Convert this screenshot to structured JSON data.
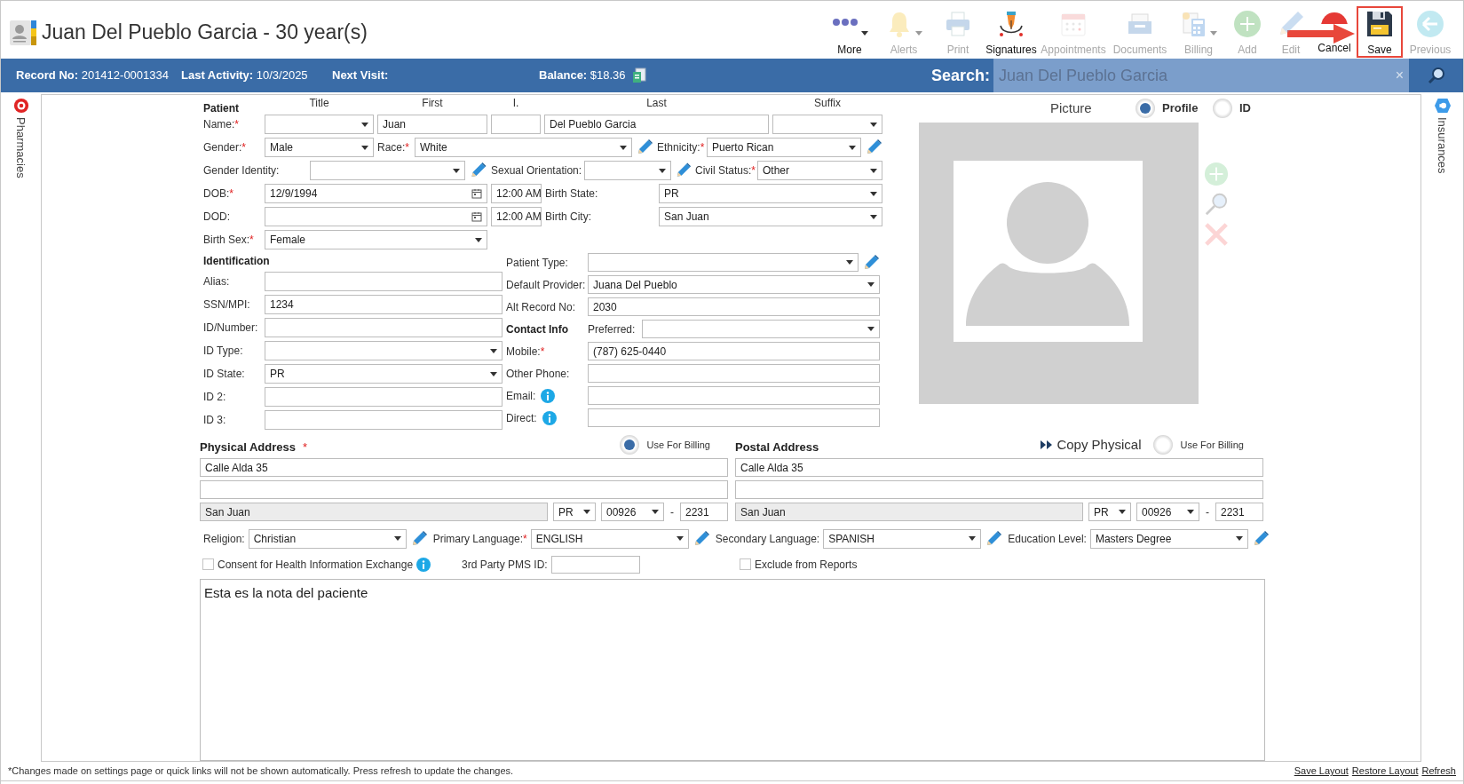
{
  "header": {
    "title": "Juan Del Pueblo Garcia - 30 year(s)"
  },
  "toolbar": [
    {
      "kind": "more",
      "label": "More",
      "disabled": false,
      "dropdown": true,
      "highlighted": false
    },
    {
      "kind": "alerts",
      "label": "Alerts",
      "disabled": true,
      "dropdown": true,
      "highlighted": false
    },
    {
      "kind": "print",
      "label": "Print",
      "disabled": true,
      "dropdown": false,
      "highlighted": false
    },
    {
      "kind": "signatures",
      "label": "Signatures",
      "disabled": false,
      "dropdown": false,
      "highlighted": false
    },
    {
      "kind": "appointments",
      "label": "Appointments",
      "disabled": true,
      "dropdown": false,
      "highlighted": false
    },
    {
      "kind": "documents",
      "label": "Documents",
      "disabled": true,
      "dropdown": false,
      "highlighted": false
    },
    {
      "kind": "billing",
      "label": "Billing",
      "disabled": true,
      "dropdown": true,
      "highlighted": false
    },
    {
      "kind": "add",
      "label": "Add",
      "disabled": true,
      "dropdown": false,
      "highlighted": false
    },
    {
      "kind": "edit",
      "label": "Edit",
      "disabled": true,
      "dropdown": false,
      "highlighted": false
    },
    {
      "kind": "cancel",
      "label": "Cancel",
      "disabled": false,
      "dropdown": false,
      "highlighted": false
    },
    {
      "kind": "save",
      "label": "Save",
      "disabled": false,
      "dropdown": false,
      "highlighted": true
    },
    {
      "kind": "previous",
      "label": "Previous",
      "disabled": true,
      "dropdown": false,
      "highlighted": false
    }
  ],
  "info_bar": [
    {
      "label": "Record No:",
      "value": "201412-0001334"
    },
    {
      "label": "Last Activity:",
      "value": "10/3/2025"
    },
    {
      "label": "Next Visit:"
    },
    {
      "label": "Balance:",
      "value": "$18.36"
    }
  ],
  "search": {
    "label": "Search:",
    "value": "Juan Del Pueblo Garcia",
    "clear": "×"
  },
  "side_tabs": {
    "left": "Pharmacies",
    "right": "Insurances"
  },
  "patient": {
    "heading": "Patient",
    "columns": [
      "Title",
      "First",
      "I.",
      "Last",
      "Suffix"
    ],
    "rows": [
      [
        {
          "kind": "label",
          "text": "Name:",
          "required_mark": "*"
        },
        {
          "kind": "select"
        },
        {
          "kind": "text",
          "value": "Juan"
        },
        {
          "kind": "text"
        },
        {
          "kind": "text",
          "value": "Del Pueblo Garcia"
        },
        {
          "kind": "select"
        }
      ],
      [
        {
          "kind": "label",
          "text": "Gender:",
          "required_mark": "*"
        },
        {
          "kind": "select",
          "value": "Male"
        },
        {
          "kind": "label",
          "text": "Race:",
          "required_mark": "*"
        },
        {
          "kind": "select",
          "value": "White"
        },
        {
          "kind": "edit"
        },
        {
          "kind": "label",
          "text": "Ethnicity:",
          "required_mark": "*"
        },
        {
          "kind": "select",
          "value": "Puerto Rican"
        },
        {
          "kind": "edit"
        }
      ],
      [
        {
          "kind": "label",
          "text": "Gender Identity:"
        },
        {
          "kind": "select"
        },
        {
          "kind": "edit"
        },
        {
          "kind": "label",
          "text": "Sexual Orientation:"
        },
        {
          "kind": "select"
        },
        {
          "kind": "edit"
        },
        {
          "kind": "label",
          "text": "Civil Status:",
          "required_mark": "*"
        },
        {
          "kind": "select",
          "value": "Other"
        }
      ],
      [
        {
          "kind": "label",
          "text": "DOB:",
          "required_mark": "*"
        },
        {
          "kind": "date",
          "value": "12/9/1994"
        },
        {
          "kind": "text",
          "value": "12:00 AM"
        },
        {
          "kind": "label",
          "text": "Birth State:"
        },
        {
          "kind": "select",
          "value": "PR"
        }
      ],
      [
        {
          "kind": "label",
          "text": "DOD:"
        },
        {
          "kind": "date"
        },
        {
          "kind": "text",
          "value": "12:00 AM"
        },
        {
          "kind": "label",
          "text": "Birth City:"
        },
        {
          "kind": "select",
          "value": "San Juan"
        }
      ],
      [
        {
          "kind": "label",
          "text": "Birth Sex:",
          "required_mark": "*"
        },
        {
          "kind": "select",
          "value": "Female"
        }
      ]
    ]
  },
  "identification": {
    "heading": "Identification",
    "rows": [
      [
        {
          "kind": "label",
          "text": "Alias:"
        },
        {
          "kind": "text"
        }
      ],
      [
        {
          "kind": "label",
          "text": "SSN/MPI:"
        },
        {
          "kind": "text",
          "value": "1234"
        }
      ],
      [
        {
          "kind": "label",
          "text": "ID/Number:"
        },
        {
          "kind": "text"
        }
      ],
      [
        {
          "kind": "label",
          "text": "ID Type:"
        },
        {
          "kind": "select"
        }
      ],
      [
        {
          "kind": "label",
          "text": "ID State:"
        },
        {
          "kind": "select",
          "value": "PR"
        }
      ],
      [
        {
          "kind": "label",
          "text": "ID 2:"
        },
        {
          "kind": "text"
        }
      ],
      [
        {
          "kind": "label",
          "text": "ID 3:"
        },
        {
          "kind": "text"
        }
      ]
    ]
  },
  "details": {
    "rows": [
      [
        {
          "kind": "label",
          "text": "Patient Type:"
        },
        {
          "kind": "select"
        },
        {
          "kind": "edit"
        }
      ],
      [
        {
          "kind": "label",
          "text": "Default Provider:"
        },
        {
          "kind": "select",
          "value": "Juana Del Pueblo"
        }
      ],
      [
        {
          "kind": "label",
          "text": "Alt Record No:"
        },
        {
          "kind": "text",
          "value": "2030"
        }
      ],
      [
        {
          "kind": "heading",
          "text": "Contact Info"
        },
        {
          "kind": "label",
          "text": "Preferred:"
        },
        {
          "kind": "select"
        }
      ],
      [
        {
          "kind": "label",
          "text": "Mobile:",
          "required_mark": "*"
        },
        {
          "kind": "text",
          "value": "(787) 625-0440"
        }
      ],
      [
        {
          "kind": "label",
          "text": "Other Phone:"
        },
        {
          "kind": "text"
        }
      ],
      [
        {
          "kind": "label",
          "text": "Email:",
          "info": true
        },
        {
          "kind": "text"
        }
      ],
      [
        {
          "kind": "label",
          "text": "Direct:",
          "info": true
        },
        {
          "kind": "text"
        }
      ]
    ]
  },
  "picture": {
    "title": "Picture",
    "options": [
      {
        "label": "Profile",
        "selected": true
      },
      {
        "label": "ID",
        "selected": false
      }
    ]
  },
  "addresses": [
    {
      "title": "Physical Address",
      "required_mark": "*",
      "billing": {
        "label": "Use For Billing",
        "selected": true
      },
      "line1": "Calle Alda 35",
      "city": "San Juan",
      "state": "PR",
      "zip": "00926",
      "separator": "-",
      "zip_ext": "2231"
    },
    {
      "title": "Postal Address",
      "copy_link": "Copy Physical",
      "billing": {
        "label": "Use For Billing",
        "selected": false
      },
      "line1": "Calle Alda 35",
      "city": "San Juan",
      "state": "PR",
      "zip": "00926",
      "separator": "-",
      "zip_ext": "2231"
    }
  ],
  "languages": [
    {
      "label": "Religion:",
      "value": "Christian"
    },
    {
      "label": "Primary Language:",
      "required_mark": "*",
      "value": "ENGLISH"
    },
    {
      "label": "Secondary Language:",
      "value": "SPANISH"
    },
    {
      "label": "Education Level:",
      "value": "Masters Degree"
    }
  ],
  "options": [
    {
      "kind": "checkbox",
      "label": "Consent for Health Information Exchange",
      "checked": false,
      "info": true
    },
    {
      "kind": "field",
      "label": "3rd Party PMS ID:"
    },
    {
      "kind": "checkbox",
      "label": "Exclude from Reports",
      "checked": false,
      "info": false
    }
  ],
  "note": {
    "value": "Esta es la nota del paciente"
  },
  "footer": {
    "message": "*Changes made on settings page or quick links will not be shown automatically. Press refresh to update the changes.",
    "links": [
      "Save Layout",
      "Restore Layout",
      "Refresh"
    ]
  }
}
